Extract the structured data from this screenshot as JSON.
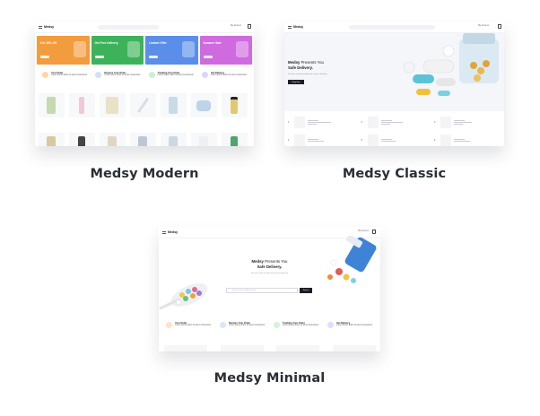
{
  "themes": [
    {
      "caption": "Medsy Modern"
    },
    {
      "caption": "Medsy Classic"
    },
    {
      "caption": "Medsy Minimal"
    }
  ],
  "mini": {
    "logo": "Medsy",
    "account": "My Account",
    "promos": [
      "Get 10% Off",
      "Get Free Delivery",
      "Limited Offer",
      "Summer Sale"
    ],
    "features": [
      {
        "title": "Your Order",
        "text": "Lorem ipsum dolor sit amet consectetur"
      },
      {
        "title": "Receive Your Order",
        "text": "Lorem ipsum dolor sit amet consectetur"
      },
      {
        "title": "Tracking Your Order",
        "text": "Lorem ipsum dolor sit amet consectetur"
      },
      {
        "title": "Get Delivery",
        "text": "Lorem ipsum dolor sit amet consectetur"
      }
    ],
    "hero_lead": "Medsy",
    "hero_rest": " Presents You",
    "hero_line2": "Safe Delivery.",
    "hero_sub": "Get your medicine delivered to your doorstep",
    "hero_button": "Shop Now",
    "search_placeholder": "Search your medicine here",
    "search_button": "Search"
  },
  "colors": {
    "promo": [
      "#f39c3d",
      "#3cb35a",
      "#5a8ee8",
      "#cf6adf"
    ],
    "feature": [
      "#ffd6a8",
      "#cfe0ff",
      "#c9f0d2",
      "#d9d5ff"
    ],
    "bottles": [
      "#c7d9b0",
      "#f0c9d8",
      "#e9e2c7",
      "#d6dde9",
      "#c9dce6",
      "#bcd3e8",
      "#e1c873"
    ]
  }
}
